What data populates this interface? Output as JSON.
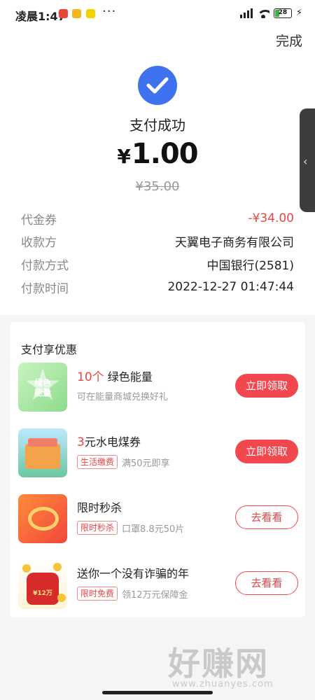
{
  "status_bar": {
    "time": "凌晨1:47",
    "dots": "···",
    "battery_level": "28",
    "battery_fraction": 0.28,
    "charging_icon": "⚡"
  },
  "header": {
    "done_label": "完成"
  },
  "result": {
    "status_text": "支付成功",
    "currency": "¥",
    "amount": "1.00",
    "original_amount": "¥35.00"
  },
  "details": [
    {
      "label": "代金券",
      "value": "-¥34.00"
    },
    {
      "label": "收款方",
      "value": "天翼电子商务有限公司"
    },
    {
      "label": "付款方式",
      "value": "中国银行(2581)"
    },
    {
      "label": "付款时间",
      "value": "2022-12-27 01:47:44"
    }
  ],
  "side_handle": {
    "chevron": "‹"
  },
  "benefits": {
    "title": "支付享优惠",
    "offers": [
      {
        "highlight": "10个",
        "title": "绿色能量",
        "thumb_text": "绿色\n能量",
        "subtitle": "可在能量商城兑换好礼",
        "button": "立即领取"
      },
      {
        "highlight": "3",
        "title": "元水电煤券",
        "tag": "生活缴费",
        "subtitle": "满50元即享",
        "button": "立即领取"
      },
      {
        "title": "限时秒杀",
        "tag": "限时秒杀",
        "subtitle": "口罩8.8元50片",
        "button": "去看看"
      },
      {
        "title": "送你一个没有诈骗的年",
        "thumb_text": "¥12万",
        "tag": "限时免费",
        "subtitle": "领12万元保障金",
        "button": "去看看"
      }
    ]
  },
  "watermark": {
    "text": "好赚网",
    "url": "www.zhuanyes.com"
  },
  "colors": {
    "accent_blue": "#3f72ee",
    "accent_red": "#f2474f",
    "price_red": "#e84545"
  }
}
